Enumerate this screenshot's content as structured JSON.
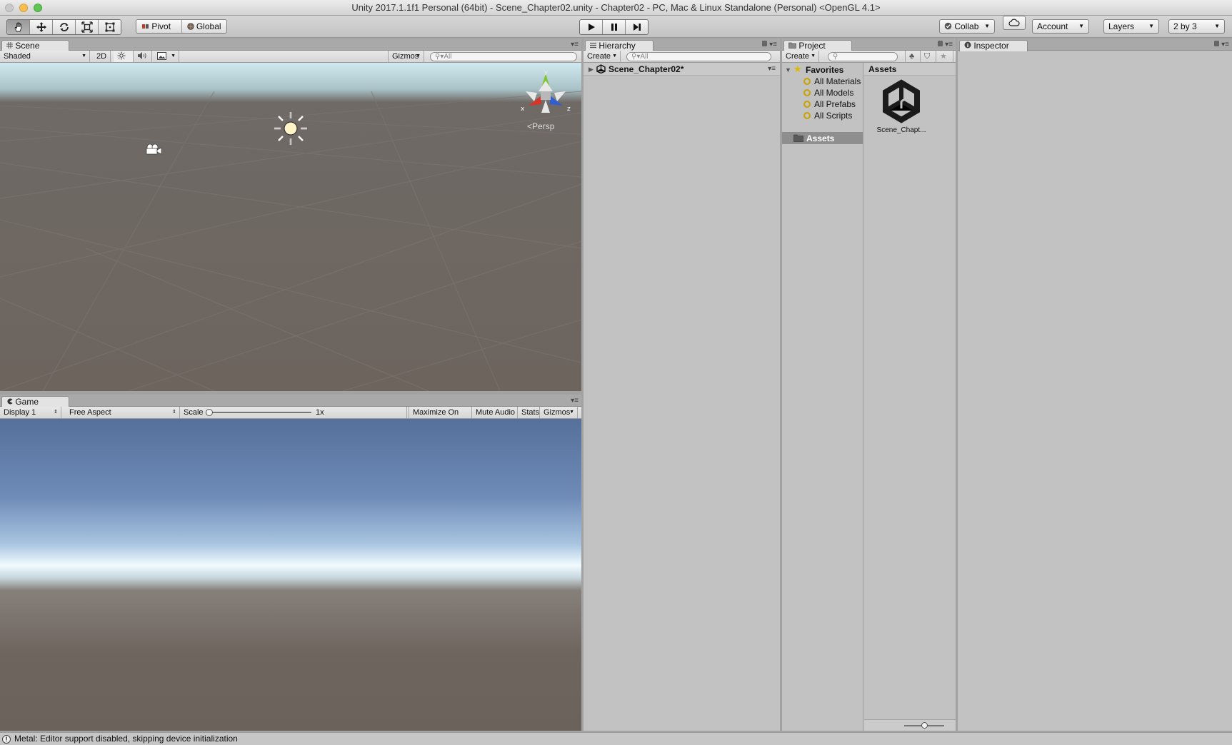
{
  "window": {
    "title": "Unity 2017.1.1f1 Personal (64bit) - Scene_Chapter02.unity - Chapter02 - PC, Mac & Linux Standalone (Personal) <OpenGL 4.1>"
  },
  "toolbar": {
    "pivot_label": "Pivot",
    "global_label": "Global",
    "collab_label": "Collab",
    "account_label": "Account",
    "layers_label": "Layers",
    "layout_label": "2 by 3"
  },
  "scene": {
    "tab_label": "Scene",
    "shading_mode": "Shaded",
    "mode_2d_label": "2D",
    "gizmos_label": "Gizmos",
    "search_placeholder": "All",
    "persp_label": "Persp",
    "axis_x": "x",
    "axis_y": "y",
    "axis_z": "z"
  },
  "game": {
    "tab_label": "Game",
    "display": "Display 1",
    "aspect": "Free Aspect",
    "scale_label": "Scale",
    "scale_value": "1x",
    "scale_fraction": 0.0,
    "maximize_label": "Maximize On Play",
    "mute_label": "Mute Audio",
    "stats_label": "Stats",
    "gizmos_label": "Gizmos"
  },
  "hierarchy": {
    "tab_label": "Hierarchy",
    "create_label": "Create",
    "search_placeholder": "All",
    "scene_name": "Scene_Chapter02*"
  },
  "project": {
    "tab_label": "Project",
    "create_label": "Create",
    "favorites_label": "Favorites",
    "favorites": [
      "All Materials",
      "All Models",
      "All Prefabs",
      "All Scripts"
    ],
    "assets_folder": "Assets",
    "assets_header": "Assets",
    "asset_items": [
      {
        "name": "Scene_Chapt..."
      }
    ],
    "icon_size_fraction": 0.5
  },
  "inspector": {
    "tab_label": "Inspector"
  },
  "status": {
    "message": "Metal: Editor support disabled, skipping device initialization"
  },
  "colors": {
    "panel_bg": "#c2c2c2",
    "selection": "#8e8e8e",
    "x_axis": "#d6352a",
    "y_axis": "#7fc42e",
    "z_axis": "#2f5fd1"
  }
}
